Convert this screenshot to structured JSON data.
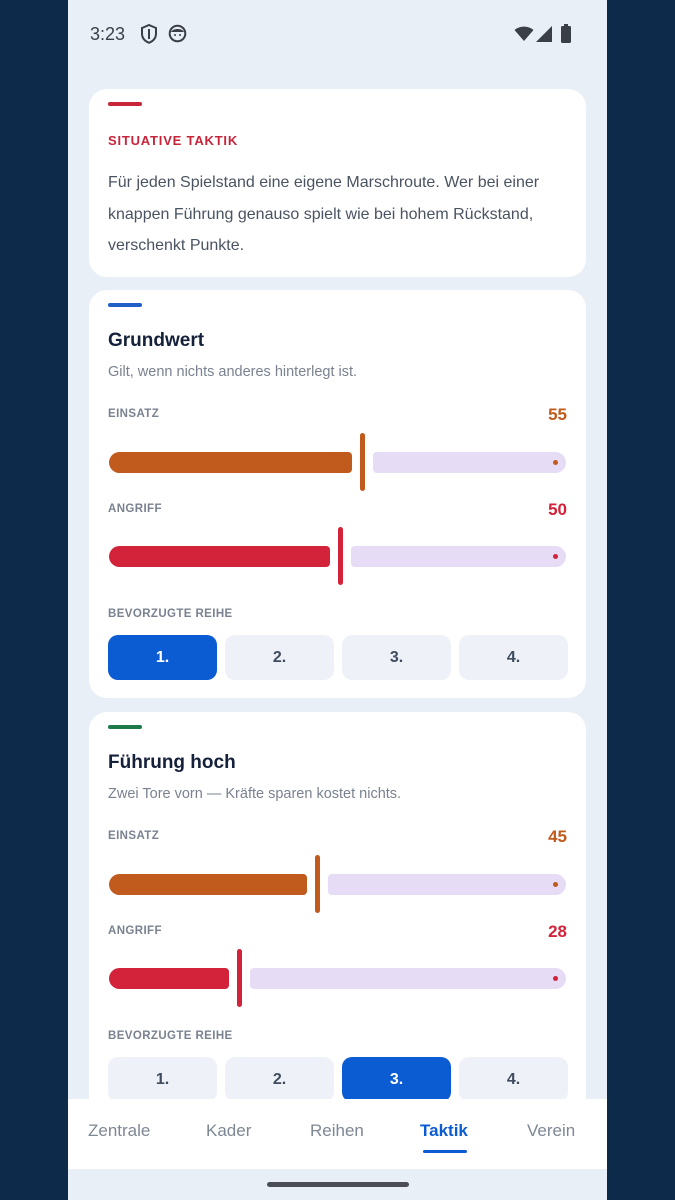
{
  "status_bar": {
    "time": "3:23",
    "icons": [
      "shield-icon",
      "face-icon",
      "wifi-icon",
      "signal-icon",
      "battery-icon"
    ]
  },
  "colors": {
    "einsatz": "#c05a1d",
    "angriff": "#d2233a",
    "accent_red": "#c8243a",
    "accent_blue": "#1f5fc8",
    "accent_green": "#1f7a4a",
    "selected": "#0b5bd3",
    "track_rest": "#e7dcf5"
  },
  "intro": {
    "eyebrow": "SITUATIVE TAKTIK",
    "text": "Für jeden Spielstand eine eigene Marschroute. Wer bei einer knappen Führung genauso spielt wie bei hohem Rückstand, verschenkt Punkte."
  },
  "tactics": [
    {
      "title": "Grundwert",
      "subtitle": "Gilt, wenn nichts anderes hinterlegt ist.",
      "einsatz_label": "EINSATZ",
      "einsatz_value": "55",
      "einsatz_level": 55,
      "angriff_label": "ANGRIFF",
      "angriff_value": "50",
      "angriff_level": 50,
      "reihe_label": "BEVORZUGTE REIHE",
      "reihen": [
        "1.",
        "2.",
        "3.",
        "4."
      ],
      "selected_reihe": 0
    },
    {
      "title": "Führung hoch",
      "subtitle": "Zwei Tore vorn — Kräfte sparen kostet nichts.",
      "einsatz_label": "EINSATZ",
      "einsatz_value": "45",
      "einsatz_level": 45,
      "angriff_label": "ANGRIFF",
      "angriff_value": "28",
      "angriff_level": 28,
      "reihe_label": "BEVORZUGTE REIHE",
      "reihen": [
        "1.",
        "2.",
        "3.",
        "4."
      ],
      "selected_reihe": 2
    }
  ],
  "nav": {
    "items": [
      "Zentrale",
      "Kader",
      "Reihen",
      "Taktik",
      "Verein"
    ],
    "active": "Taktik"
  }
}
